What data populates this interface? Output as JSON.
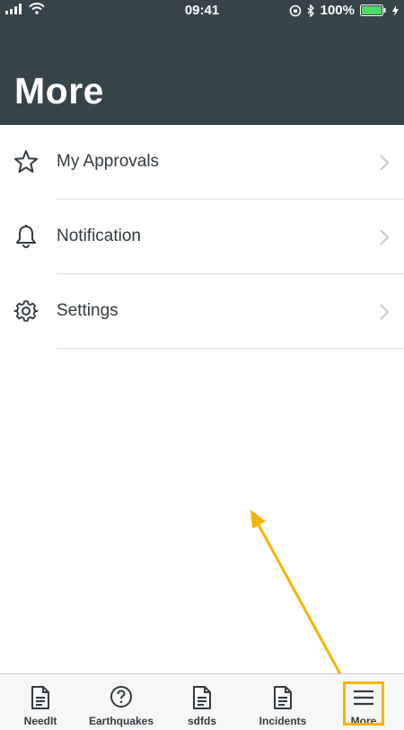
{
  "status_bar": {
    "time": "09:41",
    "battery": "100%"
  },
  "header": {
    "title": "More"
  },
  "menu": {
    "items": [
      {
        "label": "My Approvals",
        "icon": "star-icon"
      },
      {
        "label": "Notification",
        "icon": "bell-icon"
      },
      {
        "label": "Settings",
        "icon": "gear-icon"
      }
    ]
  },
  "tab_bar": {
    "tabs": [
      {
        "label": "NeedIt",
        "icon": "document-icon"
      },
      {
        "label": "Earthquakes",
        "icon": "question-circle-icon"
      },
      {
        "label": "sdfds",
        "icon": "document-icon"
      },
      {
        "label": "Incidents",
        "icon": "document-icon"
      },
      {
        "label": "More",
        "icon": "hamburger-menu-icon"
      }
    ],
    "active_tab": "More"
  },
  "colors": {
    "header_bg": "#364349",
    "text": "#333b40",
    "annotation": "#f5b400",
    "battery": "#4cd964"
  }
}
